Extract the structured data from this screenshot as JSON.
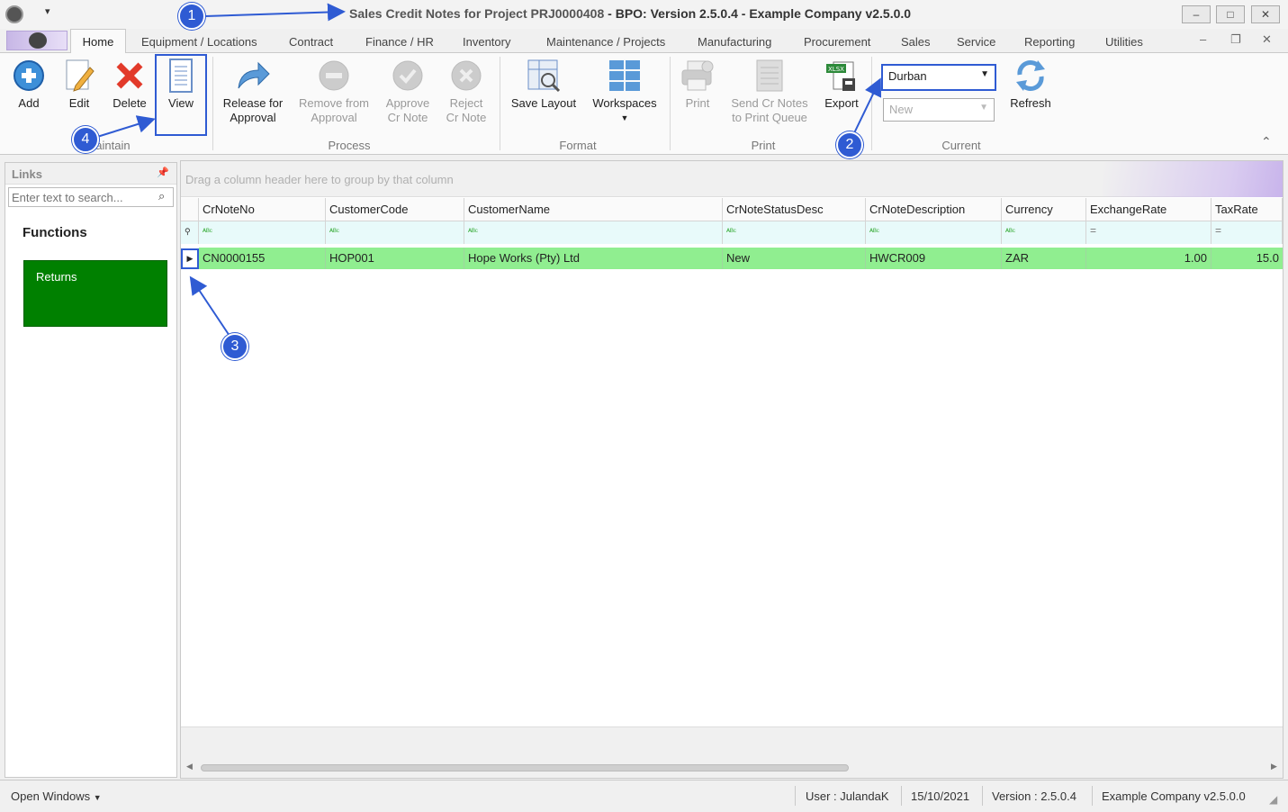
{
  "window": {
    "title_prefix": "Sales Credit Notes for Project PRJ0000408",
    "title_suffix": "BPO: Version 2.5.0.4 - Example Company v2.5.0.0",
    "title_sep": " - ",
    "min_glyph": "–",
    "max_glyph": "□",
    "close_glyph": "✕"
  },
  "menu_tabs": [
    "Home",
    "Equipment / Locations",
    "Contract",
    "Finance / HR",
    "Inventory",
    "Maintenance / Projects",
    "Manufacturing",
    "Procurement",
    "Sales",
    "Service",
    "Reporting",
    "Utilities"
  ],
  "ribbon": {
    "maintain": {
      "label": "Maintain",
      "add": "Add",
      "edit": "Edit",
      "delete": "Delete",
      "view": "View"
    },
    "process": {
      "label": "Process",
      "release_1": "Release for",
      "release_2": "Approval",
      "remove_1": "Remove from",
      "remove_2": "Approval",
      "approve_1": "Approve",
      "approve_2": "Cr Note",
      "reject_1": "Reject",
      "reject_2": "Cr Note"
    },
    "format": {
      "label": "Format",
      "save_layout": "Save Layout",
      "workspaces": "Workspaces"
    },
    "print": {
      "label": "Print",
      "print": "Print",
      "send_1": "Send Cr Notes",
      "send_2": "to Print Queue",
      "export": "Export"
    },
    "current": {
      "label": "Current",
      "site": "Durban",
      "status": "New",
      "refresh": "Refresh"
    }
  },
  "links": {
    "title": "Links",
    "search_placeholder": "Enter text to search...",
    "functions_label": "Functions",
    "tile": "Returns",
    "tile_color": "#008000"
  },
  "grid": {
    "group_hint": "Drag a column header here to group by that column",
    "columns": [
      "CrNoteNo",
      "CustomerCode",
      "CustomerName",
      "CrNoteStatusDesc",
      "CrNoteDescription",
      "Currency",
      "ExchangeRate",
      "TaxRate"
    ],
    "rows": [
      [
        "CN0000155",
        "HOP001",
        "Hope Works (Pty) Ltd",
        "New",
        "HWCR009",
        "ZAR",
        "1.00",
        "15.0"
      ]
    ],
    "row_color": "#90ee90"
  },
  "status": {
    "open_windows": "Open Windows",
    "user": "User : JulandaK",
    "date": "15/10/2021",
    "version": "Version : 2.5.0.4",
    "company": "Example Company v2.5.0.0"
  },
  "callouts": [
    "1",
    "2",
    "3",
    "4"
  ],
  "accent": "#2f5bd3"
}
